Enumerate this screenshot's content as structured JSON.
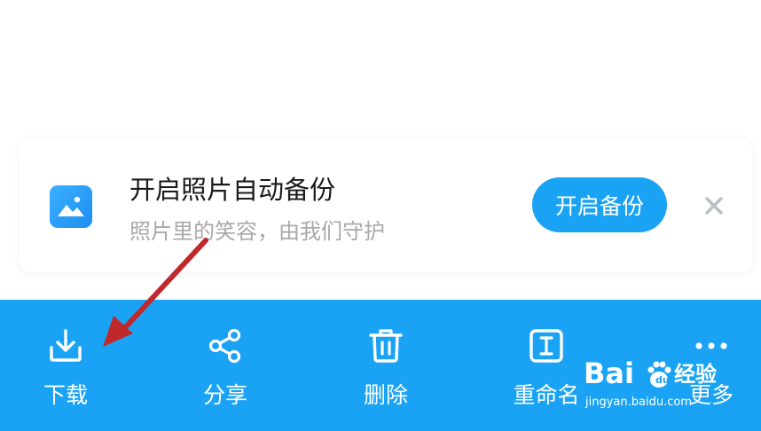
{
  "banner": {
    "title": "开启照片自动备份",
    "subtitle": "照片里的笑容，由我们守护",
    "button_label": "开启备份",
    "icon": "photo-album-icon",
    "close_icon": "close-icon"
  },
  "toolbar": {
    "items": [
      {
        "label": "下载",
        "icon": "download-icon"
      },
      {
        "label": "分享",
        "icon": "share-icon"
      },
      {
        "label": "删除",
        "icon": "trash-icon"
      },
      {
        "label": "重命名",
        "icon": "rename-icon"
      },
      {
        "label": "更多",
        "icon": "more-dots-icon"
      }
    ]
  },
  "watermark": {
    "brand": "Bai du 经验",
    "url": "jingyan.baidu.com"
  },
  "colors": {
    "accent": "#1aa3f4",
    "annotation_arrow": "#c0282b"
  }
}
